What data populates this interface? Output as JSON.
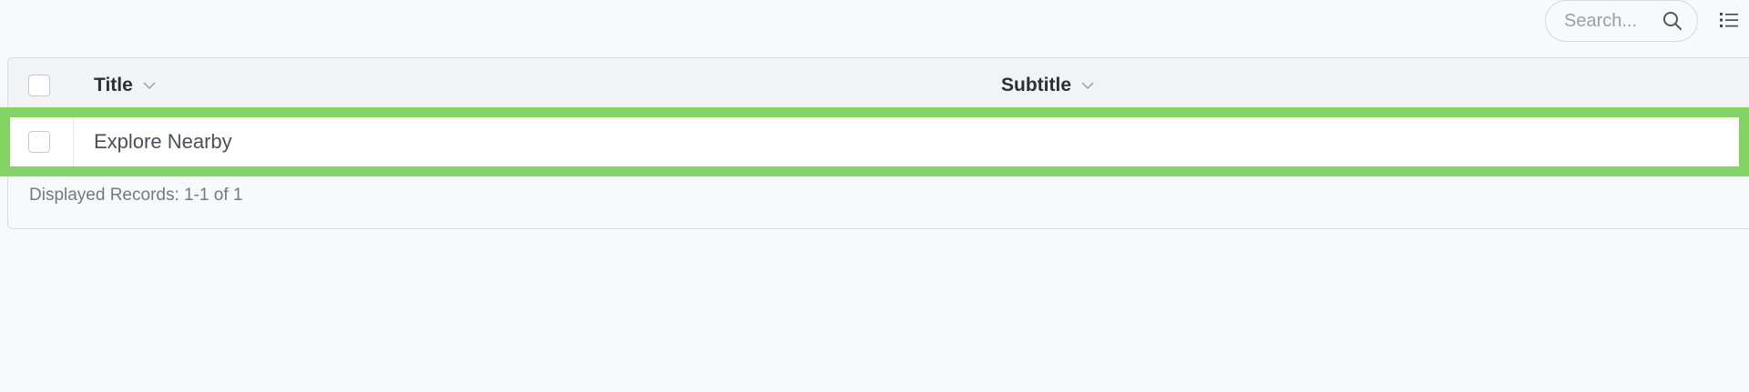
{
  "toolbar": {
    "search_placeholder": "Search...",
    "search_icon": "search-icon",
    "list_toggle_icon": "list-view-icon"
  },
  "table": {
    "columns": [
      {
        "label": "Title"
      },
      {
        "label": "Subtitle"
      }
    ],
    "rows": [
      {
        "title": "Explore Nearby",
        "subtitle": "",
        "selected": false
      }
    ],
    "select_all": false,
    "footer": "Displayed Records: 1-1 of 1"
  },
  "colors": {
    "highlight": "#84d465",
    "background": "#f8f9fb",
    "header_bg": "#f1f3f6"
  }
}
